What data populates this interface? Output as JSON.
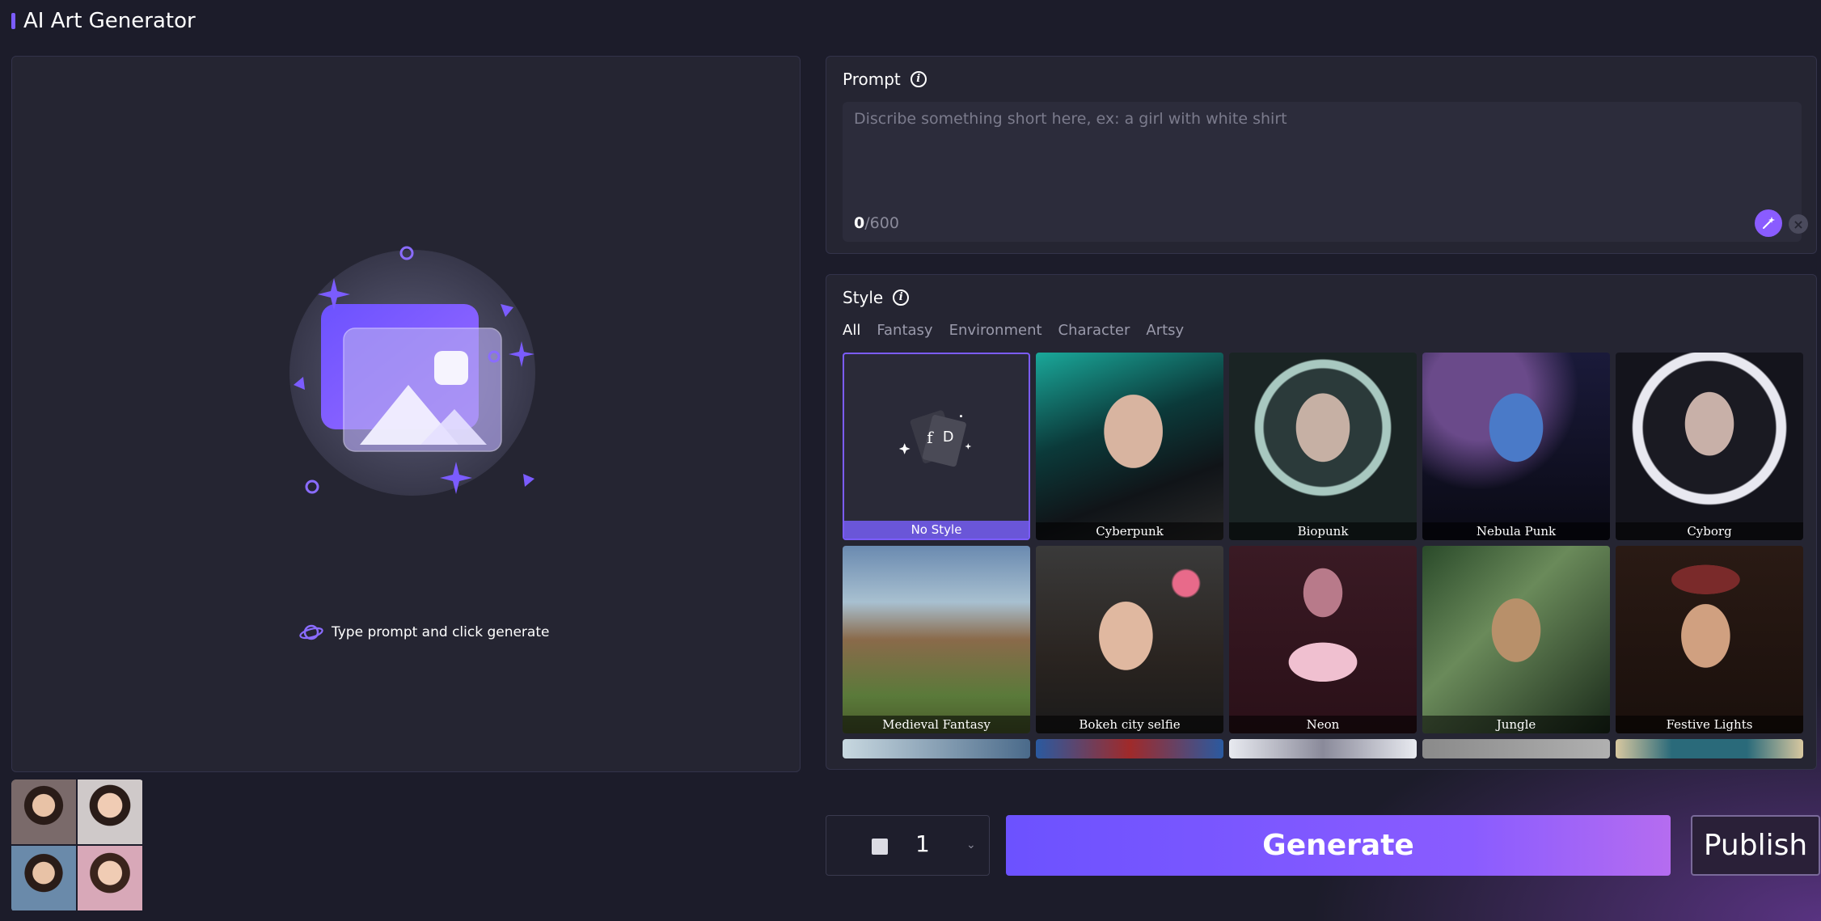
{
  "app": {
    "title": "AI Art Generator",
    "accent_color": "#7b5cff"
  },
  "preview": {
    "hint": "Type prompt and click generate",
    "hint_icon": "planet-icon",
    "illustration_icon": "image-placeholder-icon"
  },
  "prompt": {
    "label": "Prompt",
    "placeholder": "Discribe something short here, ex: a girl with white shirt",
    "value": "",
    "count_current": "0",
    "count_max": "/600"
  },
  "style": {
    "label": "Style",
    "tabs": [
      {
        "label": "All",
        "active": true
      },
      {
        "label": "Fantasy",
        "active": false
      },
      {
        "label": "Environment",
        "active": false
      },
      {
        "label": "Character",
        "active": false
      },
      {
        "label": "Artsy",
        "active": false
      }
    ],
    "cards": [
      {
        "label": "No Style",
        "selected": true
      },
      {
        "label": "Cyberpunk",
        "selected": false
      },
      {
        "label": "Biopunk",
        "selected": false
      },
      {
        "label": "Nebula Punk",
        "selected": false
      },
      {
        "label": "Cyborg",
        "selected": false
      },
      {
        "label": "Medieval Fantasy",
        "selected": false
      },
      {
        "label": "Bokeh city selfie",
        "selected": false
      },
      {
        "label": "Neon",
        "selected": false
      },
      {
        "label": "Jungle",
        "selected": false
      },
      {
        "label": "Festive Lights",
        "selected": false
      }
    ]
  },
  "controls": {
    "image_count": "1",
    "generate_label": "Generate",
    "publish_label": "Publish"
  }
}
